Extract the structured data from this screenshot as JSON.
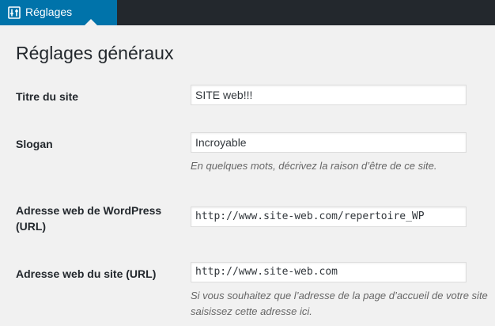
{
  "adminbar": {
    "menu_icon": "settings-sliders-icon",
    "menu_label": "Réglages"
  },
  "page": {
    "title": "Réglages généraux"
  },
  "form": {
    "site_title": {
      "label": "Titre du site",
      "value": "SITE web!!!"
    },
    "tagline": {
      "label": "Slogan",
      "value": "Incroyable",
      "description": "En quelques mots, décrivez la raison d’être de ce site."
    },
    "wp_address": {
      "label_line1": "Adresse web de WordPress",
      "label_line2": "(URL)",
      "value": "http://www.site-web.com/repertoire_WP"
    },
    "site_address": {
      "label": "Adresse web du site (URL)",
      "value": "http://www.site-web.com",
      "description_line1": "Si vous souhaitez que l’adresse de la page d’accueil de votre site",
      "description_line2": "saisissez cette adresse ici."
    }
  },
  "colors": {
    "accent": "#0073aa",
    "adminbar": "#23282d",
    "background": "#f1f1f1"
  }
}
